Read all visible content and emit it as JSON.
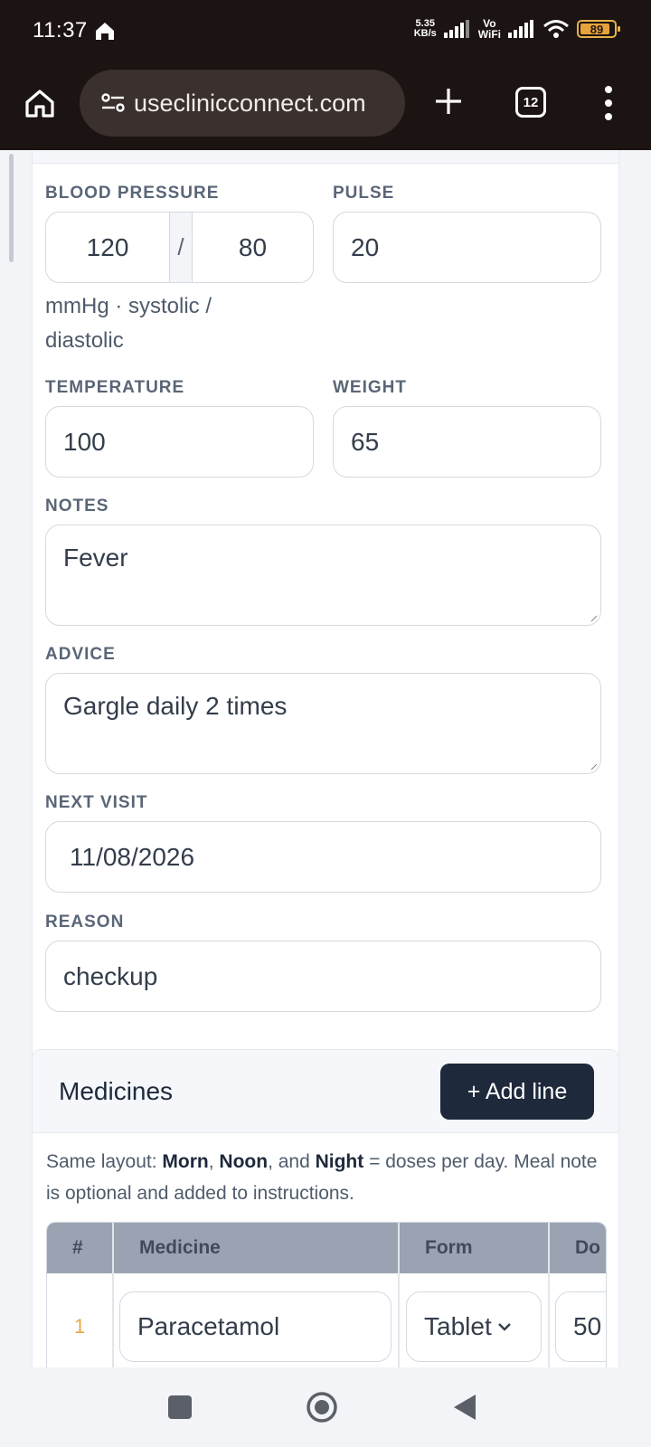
{
  "status_bar": {
    "time": "11:37",
    "net_speed_value": "5.35",
    "net_speed_unit": "KB/s",
    "vowifi_top": "Vo",
    "vowifi_bottom": "WiFi",
    "battery": "89",
    "icons": [
      "home-icon",
      "signal-icon",
      "wifi-icon",
      "battery-icon"
    ]
  },
  "browser": {
    "url": "useclinicconnect.com",
    "tab_count": "12",
    "icons": [
      "home-icon",
      "site-settings-icon",
      "new-tab-icon",
      "tabs-icon",
      "menu-icon"
    ]
  },
  "vitals": {
    "blood_pressure": {
      "label": "BLOOD PRESSURE",
      "systolic": "120",
      "separator": "/",
      "diastolic": "80",
      "hint": "mmHg · systolic / diastolic"
    },
    "pulse": {
      "label": "PULSE",
      "value": "20"
    },
    "temperature": {
      "label": "TEMPERATURE",
      "value": "100"
    },
    "weight": {
      "label": "WEIGHT",
      "value": "65"
    },
    "notes": {
      "label": "NOTES",
      "value": "Fever"
    },
    "advice": {
      "label": "ADVICE",
      "value": "Gargle daily 2 times"
    },
    "next_visit": {
      "label": "NEXT VISIT",
      "value": "11/08/2026"
    },
    "reason": {
      "label": "REASON",
      "value": "checkup"
    }
  },
  "medicines": {
    "title": "Medicines",
    "add_button": "+ Add line",
    "note_parts": [
      "Same layout: ",
      "Morn",
      ", ",
      "Noon",
      ", and ",
      "Night",
      " = doses per day. Meal note is optional and added to instructions."
    ],
    "columns": [
      "#",
      "Medicine",
      "Form",
      "Do"
    ],
    "rows": [
      {
        "num": "1",
        "medicine": "Paracetamol",
        "form": "Tablet",
        "dose": "50"
      }
    ]
  },
  "accent_colors": {
    "dark_button": "#1e293b",
    "row_number": "#e8a54c",
    "table_header": "#9aa3b2"
  }
}
